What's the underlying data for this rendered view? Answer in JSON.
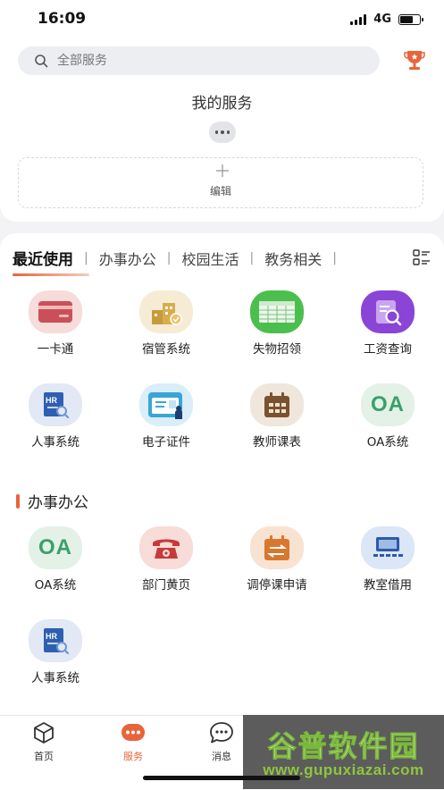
{
  "status_bar": {
    "time": "16:09",
    "network": "4G"
  },
  "search": {
    "placeholder": "全部服务"
  },
  "my_services": {
    "title": "我的服务",
    "edit_label": "编辑"
  },
  "tabs": [
    {
      "label": "最近使用",
      "active": true
    },
    {
      "label": "办事办公"
    },
    {
      "label": "校园生活"
    },
    {
      "label": "教务相关"
    }
  ],
  "recent": [
    {
      "label": "一卡通",
      "icon": "card-icon"
    },
    {
      "label": "宿管系统",
      "icon": "dorm-icon"
    },
    {
      "label": "失物招领",
      "icon": "lost-found-icon"
    },
    {
      "label": "工资查询",
      "icon": "salary-query-icon"
    },
    {
      "label": "人事系统",
      "icon": "hr-icon"
    },
    {
      "label": "电子证件",
      "icon": "id-card-icon"
    },
    {
      "label": "教师课表",
      "icon": "calendar-icon"
    },
    {
      "label": "OA系统",
      "icon": "oa-icon",
      "glyph": "OA"
    }
  ],
  "office_section": {
    "title": "办事办公",
    "items": [
      {
        "label": "OA系统",
        "icon": "oa-icon",
        "glyph": "OA"
      },
      {
        "label": "部门黄页",
        "icon": "phone-icon"
      },
      {
        "label": "调停课申请",
        "icon": "schedule-change-icon"
      },
      {
        "label": "教室借用",
        "icon": "classroom-icon"
      },
      {
        "label": "人事系统",
        "icon": "hr-icon"
      }
    ]
  },
  "bottom_nav": [
    {
      "label": "首页",
      "icon": "cube-icon"
    },
    {
      "label": "服务",
      "icon": "services-icon",
      "active": true
    },
    {
      "label": "消息",
      "icon": "message-icon"
    }
  ],
  "watermark": {
    "text": "谷普软件园",
    "url": "www.gupuxiazai.com"
  },
  "colors": {
    "accent": "#e8643a",
    "background": "#f3f3f5"
  }
}
